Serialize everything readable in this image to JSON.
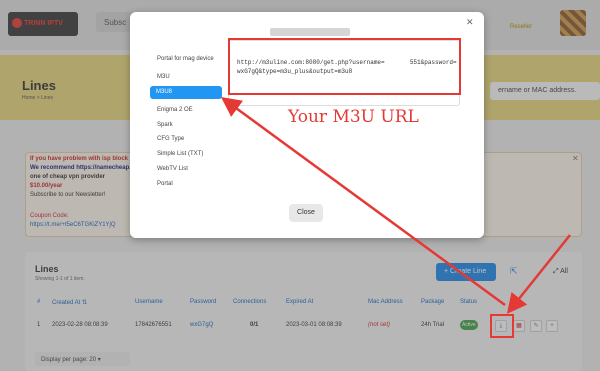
{
  "header": {
    "logo_text": "TRINN IPTV",
    "search_label": "Subsc",
    "user_status": "Reseller"
  },
  "page": {
    "title": "Lines",
    "breadcrumb": "Home > Lines",
    "search_placeholder": "ername or MAC address."
  },
  "notice": {
    "line1": "If you have problem with isp block p",
    "line2": "We recommend https://namecheap.",
    "line3": "one of cheap vpn provider",
    "line4": "$10.00/year",
    "line5": "Subscribe to our Newsletter!",
    "coupon_label": "Coupon Code:",
    "coupon_link": "https://t.me/+t5eC6TGKiZY1YjQ"
  },
  "lines_table": {
    "title": "Lines",
    "subtitle": "Showing 1-1 of 1 item.",
    "create_button": "+ Create Line",
    "all_label": "All",
    "headers": [
      "#",
      "Created At",
      "Username",
      "Password",
      "Connections",
      "Expired At",
      "Mac Address",
      "Package",
      "Status"
    ],
    "rows": [
      {
        "index": "1",
        "created": "2023-02-28 08:08:39",
        "username": "17842676551",
        "password": "wxG7gQ",
        "connections": "0/1",
        "expired": "2023-03-01 08:08:39",
        "mac": "(not set)",
        "package": "24h Trial",
        "status": "Active"
      }
    ],
    "per_page_label": "Display per page: 20"
  },
  "modal": {
    "close_button": "Close",
    "tabs": [
      "Portal for mag device",
      "M3U",
      "M3U8",
      "Enigma 2 OE",
      "Spark",
      "CFG Type",
      "Simple List (TXT)",
      "WebTV List",
      "Portal"
    ],
    "active_tab": "M3U8",
    "url_text": "http://m3uline.com:8080/get.php?username=       551&password=wxG7gQ&type=m3u_plus&output=m3u8"
  },
  "annotation": {
    "caption": "Your M3U URL",
    "accent_color": "#e53935"
  }
}
